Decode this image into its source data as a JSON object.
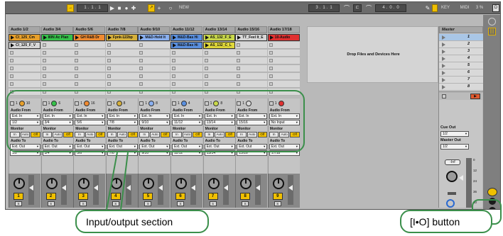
{
  "transport": {
    "arrangement_pos": "1 .  1 .  1",
    "new_label": "NEW",
    "loop_start": "3 .  1 .  1",
    "loop_length": "4 .  0 .  0",
    "key_label": "KEY",
    "midi_label": "MIDI",
    "cpu": "3 %",
    "d_label": "D"
  },
  "tracks": [
    {
      "name": "Audio 1/2",
      "clip1": "CI_125_Cm",
      "clip1_color": "#e8a02a",
      "clip2": "CI_125_F_V",
      "clip2_color": "#d8d8d8",
      "arm_num": "10",
      "input_channel": "1/2",
      "output_channel": "1/2",
      "mixer_num": "1"
    },
    {
      "name": "Audio 3/4",
      "clip1": "80N Ac Plan",
      "clip1_color": "#35c24a",
      "clip2": "",
      "clip2_color": "",
      "arm_num": "6",
      "input_channel": "3/4",
      "output_channel": "3/4",
      "mixer_num": "2"
    },
    {
      "name": "Audio 5/6",
      "clip1": "GH R&B Dr",
      "clip1_color": "#f08a30",
      "clip2": "",
      "clip2_color": "",
      "arm_num": "16",
      "input_channel": "5/6",
      "output_channel": "5/6",
      "mixer_num": "3"
    },
    {
      "name": "Audio 7/8",
      "clip1": "Fpnk-122bp",
      "clip1_color": "#d6b03a",
      "clip2": "",
      "clip2_color": "",
      "arm_num": "8",
      "input_channel": "7/8",
      "output_channel": "7/8",
      "mixer_num": "4"
    },
    {
      "name": "Audio 9/10",
      "clip1": "M&D-Hold It",
      "clip1_color": "#8ab0f0",
      "clip2": "",
      "clip2_color": "",
      "arm_num": "8",
      "input_channel": "9/10",
      "output_channel": "9/10",
      "mixer_num": "5"
    },
    {
      "name": "Audio 11/12",
      "clip1": "M&D-Bas Hi",
      "clip1_color": "#5a90e0",
      "clip2": "M&D-Bas Hi",
      "clip2_color": "#5a90e0",
      "arm_num": "4",
      "input_channel": "11/12",
      "output_channel": "11/12",
      "mixer_num": "6"
    },
    {
      "name": "Audio 13/14",
      "clip1": "AS_132_F_E",
      "clip1_color": "#c9d84a",
      "clip2": "AS_132_C_L",
      "clip2_color": "#e0d83a",
      "arm_num": "8",
      "input_channel": "13/14",
      "output_channel": "13/14",
      "mixer_num": "7"
    },
    {
      "name": "Audio 15/16",
      "clip1": "TT_Feel It_E",
      "clip1_color": "#d8d8d8",
      "clip2": "",
      "clip2_color": "",
      "arm_num": "",
      "input_channel": "15/16",
      "output_channel": "15/16",
      "mixer_num": "8"
    },
    {
      "name": "Audio 17/18",
      "clip1": "10-Audio",
      "clip1_color": "#e03030",
      "clip2": "",
      "clip2_color": "",
      "arm_num": "",
      "input_channel": "No Input",
      "output_channel": "17/18",
      "mixer_num": "9"
    }
  ],
  "io_labels": {
    "audio_from": "Audio From",
    "ext_in": "Ext. In",
    "monitor": "Monitor",
    "mon_in": "In",
    "mon_auto": "Auto",
    "mon_off": "Off",
    "audio_to": "Audio To",
    "ext_out": "Ext. Out"
  },
  "mixer": {
    "solo_label": "S"
  },
  "master": {
    "title": "Master",
    "scenes": [
      "1",
      "2",
      "3",
      "4",
      "5",
      "6",
      "7",
      "8"
    ],
    "cue_out_label": "Cue Out",
    "cue_out_value": "1/2",
    "master_out_label": "Master Out",
    "master_out_value": "1/2",
    "volume": "-Inf",
    "db_ticks": [
      "0",
      "12",
      "24",
      "36",
      "60"
    ]
  },
  "drop_zone_text": "Drop Files and Devices Here",
  "callouts": {
    "io_section": "Input/output section",
    "io_button": "[I•O] button"
  },
  "colors": {
    "accent": "#f0c000",
    "callout_border": "#3b8f4b"
  }
}
